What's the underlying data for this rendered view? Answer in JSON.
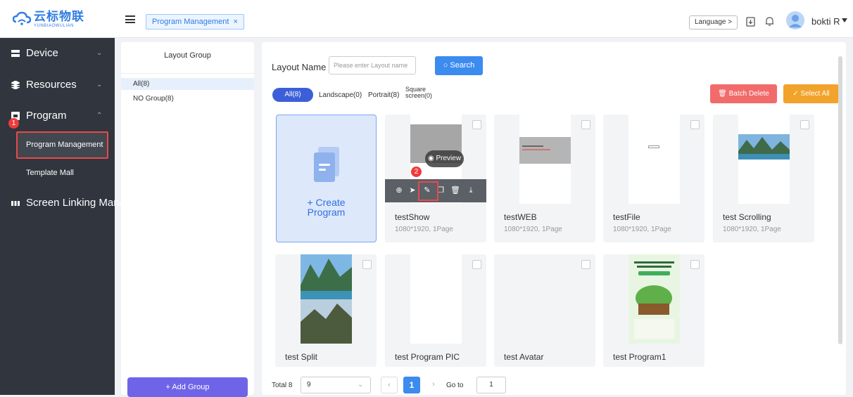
{
  "header": {
    "logo_cn": "云标物联",
    "logo_en": "YUNBIAOWULIAN",
    "open_tab": "Program Management",
    "language_btn": "Language >",
    "user_name": "bokti R"
  },
  "sidebar": {
    "items": [
      {
        "label": "Device"
      },
      {
        "label": "Resources"
      },
      {
        "label": "Program"
      },
      {
        "label": "Screen Linking Mana"
      }
    ],
    "sub_items": [
      "Program Management",
      "Template Mall"
    ],
    "step_marker": "1"
  },
  "groups": {
    "title": "Layout Group",
    "items": [
      "All(8)",
      "NO Group(8)"
    ],
    "add_btn": "+ Add Group"
  },
  "toolbar": {
    "layout_name_label": "Layout Name",
    "search_placeholder": "Please enter Layout name",
    "search_btn": "Search",
    "filters": [
      "All(8)",
      "Landscape(0)",
      "Portrait(8)",
      "Square screen(0)"
    ],
    "batch_delete": "Batch Delete",
    "select_all": "Select All"
  },
  "create_card": {
    "line1": "+ Create",
    "line2": "Program"
  },
  "hover": {
    "preview": "Preview",
    "step_marker": "2"
  },
  "cards": [
    {
      "name": "testShow",
      "meta": "1080*1920, 1Page"
    },
    {
      "name": "testWEB",
      "meta": "1080*1920, 1Page"
    },
    {
      "name": "testFile",
      "meta": "1080*1920, 1Page"
    },
    {
      "name": "test Scrolling",
      "meta": "1080*1920, 1Page"
    },
    {
      "name": "test Split",
      "meta": ""
    },
    {
      "name": "test Program PIC",
      "meta": ""
    },
    {
      "name": "test Avatar",
      "meta": ""
    },
    {
      "name": "test Program1",
      "meta": ""
    }
  ],
  "pagination": {
    "total": "Total 8",
    "page_size": "9",
    "current": "1",
    "goto_label": "Go to",
    "goto_value": "1"
  },
  "colors": {
    "accent": "#3c8bef",
    "sidebar": "#30353e",
    "danger": "#f26b6b",
    "warning": "#f2a32c",
    "highlight": "#e84a4a",
    "add_group": "#6f64e8"
  }
}
